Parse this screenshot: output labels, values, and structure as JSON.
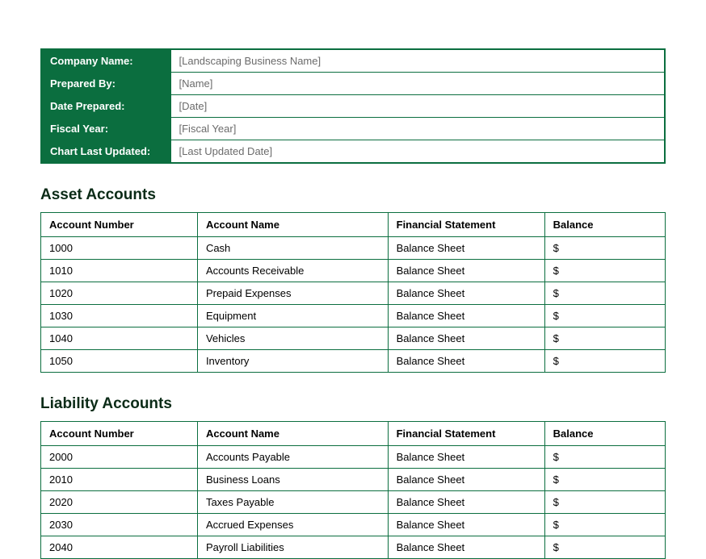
{
  "info": {
    "rows": [
      {
        "label": "Company Name:",
        "value": "[Landscaping Business Name]"
      },
      {
        "label": "Prepared By:",
        "value": "[Name]"
      },
      {
        "label": "Date Prepared:",
        "value": "[Date]"
      },
      {
        "label": "Fiscal Year:",
        "value": "[Fiscal Year]"
      },
      {
        "label": "Chart Last Updated:",
        "value": "[Last Updated Date]"
      }
    ]
  },
  "tableHeaders": {
    "num": "Account Number",
    "name": "Account Name",
    "stmt": "Financial Statement",
    "bal": "Balance"
  },
  "assets": {
    "heading": "Asset Accounts",
    "rows": [
      {
        "num": "1000",
        "name": "Cash",
        "stmt": "Balance Sheet",
        "bal": "$"
      },
      {
        "num": "1010",
        "name": "Accounts Receivable",
        "stmt": "Balance Sheet",
        "bal": "$"
      },
      {
        "num": "1020",
        "name": "Prepaid Expenses",
        "stmt": "Balance Sheet",
        "bal": "$"
      },
      {
        "num": "1030",
        "name": "Equipment",
        "stmt": "Balance Sheet",
        "bal": "$"
      },
      {
        "num": "1040",
        "name": "Vehicles",
        "stmt": "Balance Sheet",
        "bal": "$"
      },
      {
        "num": "1050",
        "name": "Inventory",
        "stmt": "Balance Sheet",
        "bal": "$"
      }
    ]
  },
  "liabilities": {
    "heading": "Liability Accounts",
    "rows": [
      {
        "num": "2000",
        "name": "Accounts Payable",
        "stmt": "Balance Sheet",
        "bal": "$"
      },
      {
        "num": "2010",
        "name": "Business Loans",
        "stmt": "Balance Sheet",
        "bal": "$"
      },
      {
        "num": "2020",
        "name": "Taxes Payable",
        "stmt": "Balance Sheet",
        "bal": "$"
      },
      {
        "num": "2030",
        "name": "Accrued Expenses",
        "stmt": "Balance Sheet",
        "bal": "$"
      },
      {
        "num": "2040",
        "name": "Payroll Liabilities",
        "stmt": "Balance Sheet",
        "bal": "$"
      }
    ]
  }
}
